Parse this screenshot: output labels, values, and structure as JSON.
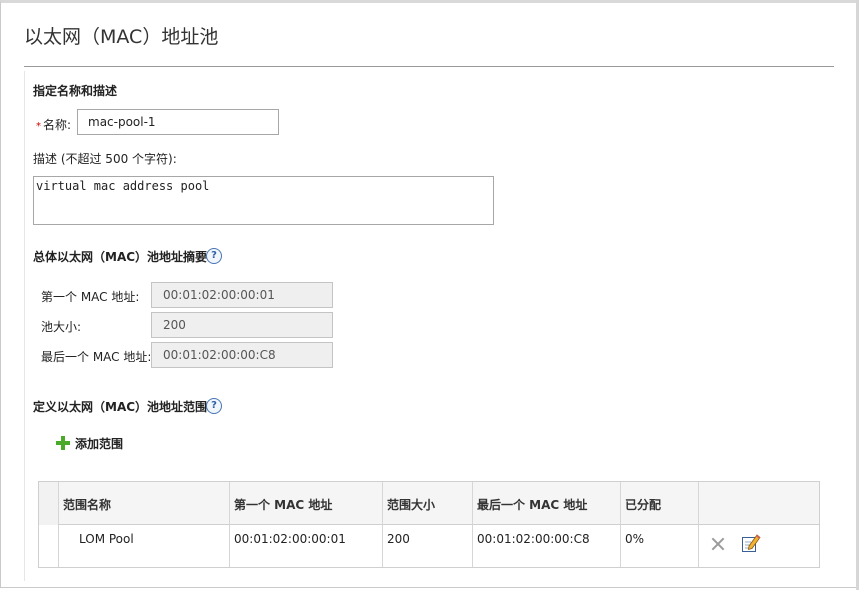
{
  "page": {
    "title": "以太网（MAC）地址池"
  },
  "name_section": {
    "heading": "指定名称和描述",
    "required_mark": "*",
    "name_label": "名称:",
    "name_value": "mac-pool-1",
    "desc_label": "描述 (不超过 500 个字符):",
    "desc_value": "virtual mac address pool"
  },
  "summary": {
    "heading": "总体以太网（MAC）池地址摘要",
    "help": "?",
    "first_label": "第一个 MAC 地址:",
    "first_value": "00:01:02:00:00:01",
    "size_label": "池大小:",
    "size_value": "200",
    "last_label": "最后一个 MAC 地址:",
    "last_value": "00:01:02:00:00:C8"
  },
  "ranges": {
    "heading": "定义以太网（MAC）池地址范围",
    "help": "?",
    "add_label": "添加范围",
    "columns": [
      "范围名称",
      "第一个 MAC 地址",
      "范围大小",
      "最后一个 MAC 地址",
      "已分配"
    ],
    "rows": [
      {
        "name": "LOM Pool",
        "first": "00:01:02:00:00:01",
        "size": "200",
        "last": "00:01:02:00:00:C8",
        "allocated": "0%"
      }
    ]
  },
  "icons": {
    "add": "plus-icon",
    "help": "help-icon",
    "delete": "delete-icon",
    "edit": "edit-icon"
  },
  "colors": {
    "add_green": "#4caa2b",
    "help_blue": "#2f5fa6",
    "readonly_bg": "#efefef"
  }
}
